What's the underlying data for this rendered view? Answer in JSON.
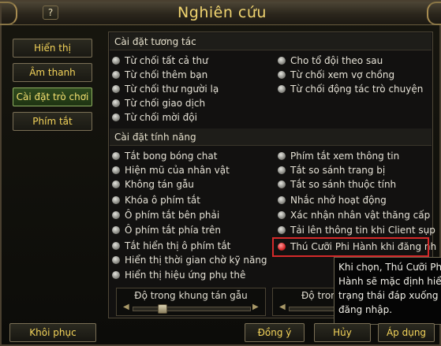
{
  "window": {
    "title": "Nghiên cứu",
    "help_icon": "?",
    "close_icon": "X"
  },
  "sidebar": {
    "items": [
      {
        "label": "Hiển thị"
      },
      {
        "label": "Âm thanh"
      },
      {
        "label": "Cài đặt trò chơi",
        "active": true
      },
      {
        "label": "Phím tắt"
      }
    ]
  },
  "interaction": {
    "header": "Cài đặt tương tác",
    "left": [
      "Từ chối tất cả thư",
      "Từ chối thêm bạn",
      "Từ chối thư người lạ",
      "Từ chối giao dịch",
      "Từ chối mời đội"
    ],
    "right": [
      "Cho tổ đội theo sau",
      "Từ chối xem vợ chồng",
      "Từ chối động tác trò chuyện"
    ]
  },
  "features": {
    "header": "Cài đặt tính năng",
    "left": [
      "Tắt bong bóng chat",
      "Hiện mũ của nhân vật",
      "Không tán gẫu",
      "Khóa ô phím tắt",
      "Ô phím tắt bên phải",
      "Ô phím tắt phía trên",
      "Tắt hiển thị ô phím tắt",
      "Hiển thị thời gian chờ kỹ năng",
      "Hiển thị hiệu ứng phụ thê"
    ],
    "right": [
      "Phím tắt xem thông tin",
      "Tắt so sánh trang bị",
      "Tắt so sánh thuộc tính",
      "Nhắc nhở hoạt động",
      "Xác nhận nhân vật thăng cấp",
      "Tải lên thông tin khi Client sụp",
      "Thú Cưỡi Phi Hành khi đăng nh"
    ]
  },
  "sliders": {
    "chat_opacity": "Độ trong khung tán gẫu",
    "second": "Độ trong"
  },
  "tooltip": {
    "lines": [
      "Khi chọn, Thú Cưỡi Phi",
      "Hành sẽ mặc định hiển",
      "trạng thái đáp xuống kh",
      "đăng nhập."
    ]
  },
  "buttons": {
    "restore": "Khôi phục",
    "agree": "Đồng ý",
    "cancel": "Hủy",
    "apply": "Áp dụng"
  },
  "colors": {
    "accent": "#f4d45a",
    "active_tab": "#2f4a1e",
    "highlight": "#d42a2a"
  }
}
